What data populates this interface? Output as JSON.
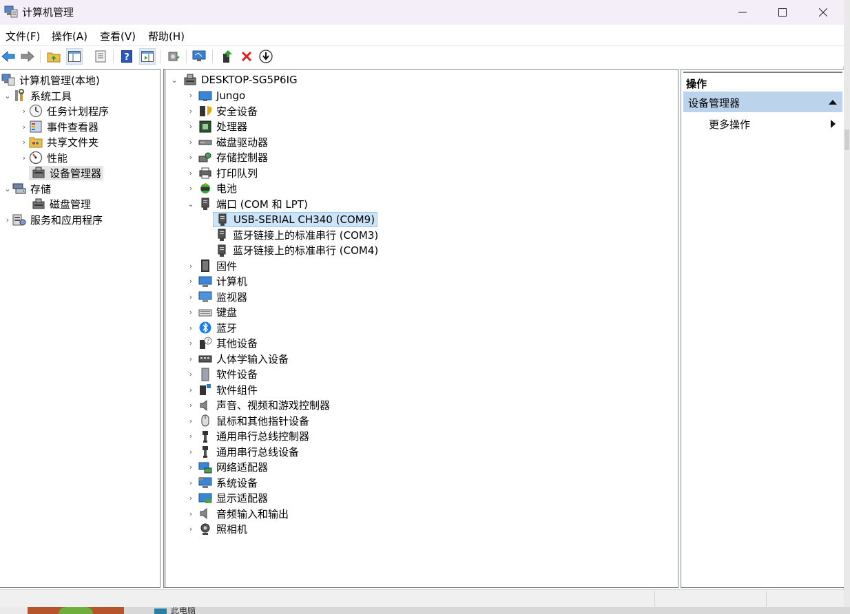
{
  "window": {
    "title": "计算机管理",
    "minimize_label": "minimize",
    "maximize_label": "maximize",
    "close_label": "close"
  },
  "menu": {
    "items": [
      "文件(F)",
      "操作(A)",
      "查看(V)",
      "帮助(H)"
    ]
  },
  "toolbar": {
    "icons": [
      "back-arrow-icon",
      "forward-arrow-icon",
      "folder-up-icon",
      "show-hide-tree-icon",
      "properties-icon",
      "help-icon",
      "show-action-pane-icon",
      "update-driver-icon",
      "scan-hardware-icon",
      "enable-device-icon",
      "uninstall-device-icon",
      "disable-device-icon"
    ]
  },
  "left_tree": {
    "root": "计算机管理(本地)",
    "system_tools": "系统工具",
    "task_scheduler": "任务计划程序",
    "event_viewer": "事件查看器",
    "shared_folders": "共享文件夹",
    "performance": "性能",
    "device_manager": "设备管理器",
    "storage": "存储",
    "disk_management": "磁盘管理",
    "services_apps": "服务和应用程序"
  },
  "device_tree": {
    "computer": "DESKTOP-SG5P6IG",
    "categories": [
      "Jungo",
      "安全设备",
      "处理器",
      "磁盘驱动器",
      "存储控制器",
      "打印队列",
      "电池",
      "端口 (COM 和 LPT)",
      "固件",
      "计算机",
      "监视器",
      "键盘",
      "蓝牙",
      "其他设备",
      "人体学输入设备",
      "软件设备",
      "软件组件",
      "声音、视频和游戏控制器",
      "鼠标和其他指针设备",
      "通用串行总线控制器",
      "通用串行总线设备",
      "网络适配器",
      "系统设备",
      "显示适配器",
      "音频输入和输出",
      "照相机"
    ],
    "ports": [
      "USB-SERIAL CH340 (COM9)",
      "蓝牙链接上的标准串行 (COM3)",
      "蓝牙链接上的标准串行 (COM4)"
    ]
  },
  "actions": {
    "header": "操作",
    "section": "设备管理器",
    "more": "更多操作"
  },
  "desktop": {
    "taskbar_text": "此电脑"
  }
}
